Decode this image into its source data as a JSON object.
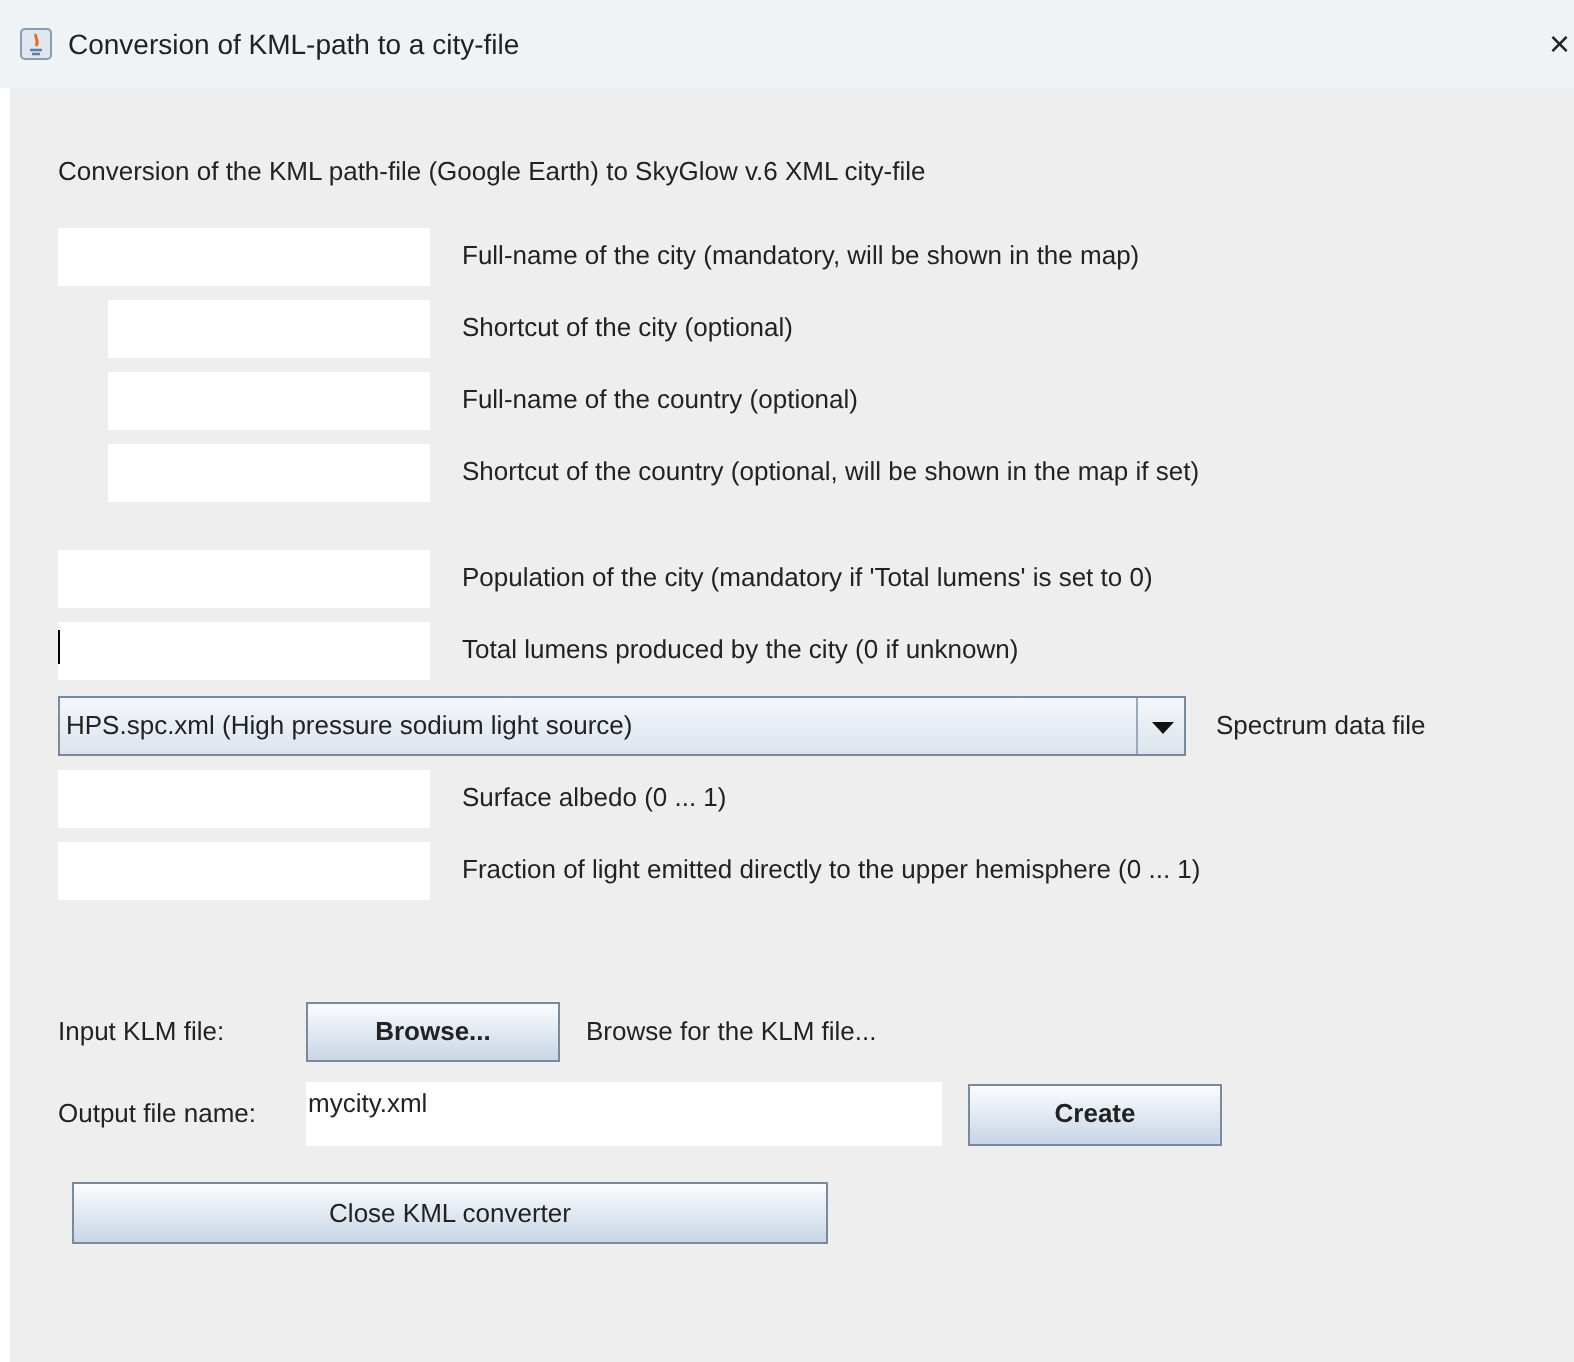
{
  "window": {
    "title": "Conversion of KML-path to a city-file",
    "close": "×"
  },
  "heading": "Conversion of the KML path-file (Google Earth) to SkyGlow v.6 XML city-file",
  "rows": [
    {
      "kind": "field",
      "indented": false,
      "focused": false,
      "label": "Full-name of the city (mandatory, will be shown in the map)"
    },
    {
      "kind": "field",
      "indented": true,
      "focused": false,
      "label": "Shortcut of the city (optional)"
    },
    {
      "kind": "field",
      "indented": true,
      "focused": false,
      "label": "Full-name of the country (optional)"
    },
    {
      "kind": "field",
      "indented": true,
      "focused": false,
      "label": "Shortcut of the country (optional, will be shown in the map if set)"
    },
    {
      "kind": "gap"
    },
    {
      "kind": "field",
      "indented": false,
      "focused": false,
      "label": "Population of the city (mandatory if 'Total lumens' is set to 0)"
    },
    {
      "kind": "field",
      "indented": false,
      "focused": true,
      "label": "Total lumens produced by the city (0 if unknown)"
    },
    {
      "kind": "dropdown",
      "selected_option": "HPS.spc.xml (High pressure sodium light source)",
      "label": "Spectrum data file"
    },
    {
      "kind": "field",
      "indented": false,
      "focused": false,
      "label": "Surface albedo (0 ... 1)"
    },
    {
      "kind": "field",
      "indented": false,
      "focused": false,
      "label": "Fraction of light emitted directly to the upper hemisphere (0 ... 1)"
    }
  ],
  "input_file": {
    "label": "Input KLM file:",
    "button": "Browse...",
    "hint": "Browse for the KLM file..."
  },
  "output_file": {
    "label": "Output file name:",
    "value": "mycity.xml",
    "button": "Create"
  },
  "close_button": "Close KML converter"
}
